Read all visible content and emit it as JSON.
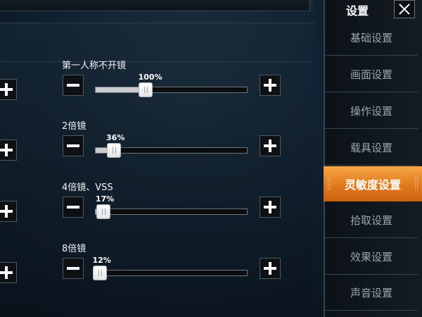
{
  "sidebar": {
    "title": "设置",
    "items": [
      {
        "label": "基础设置",
        "active": false
      },
      {
        "label": "画面设置",
        "active": false
      },
      {
        "label": "操作设置",
        "active": false
      },
      {
        "label": "载具设置",
        "active": false
      },
      {
        "label": "灵敏度设置",
        "active": true
      },
      {
        "label": "拾取设置",
        "active": false
      },
      {
        "label": "效果设置",
        "active": false
      },
      {
        "label": "声音设置",
        "active": false
      }
    ],
    "active_color": "#e8842a"
  },
  "sliders": [
    {
      "label": "第一人称不开镜",
      "value_text": "100%",
      "fraction": 0.33
    },
    {
      "label": "2倍镜",
      "value_text": "36%",
      "fraction": 0.12
    },
    {
      "label": "4倍镜、VSS",
      "value_text": "17%",
      "fraction": 0.05
    },
    {
      "label": "8倍镜",
      "value_text": "12%",
      "fraction": 0.03
    }
  ],
  "icons": {
    "plus": "plus-icon",
    "minus": "minus-icon",
    "close": "close-icon"
  }
}
